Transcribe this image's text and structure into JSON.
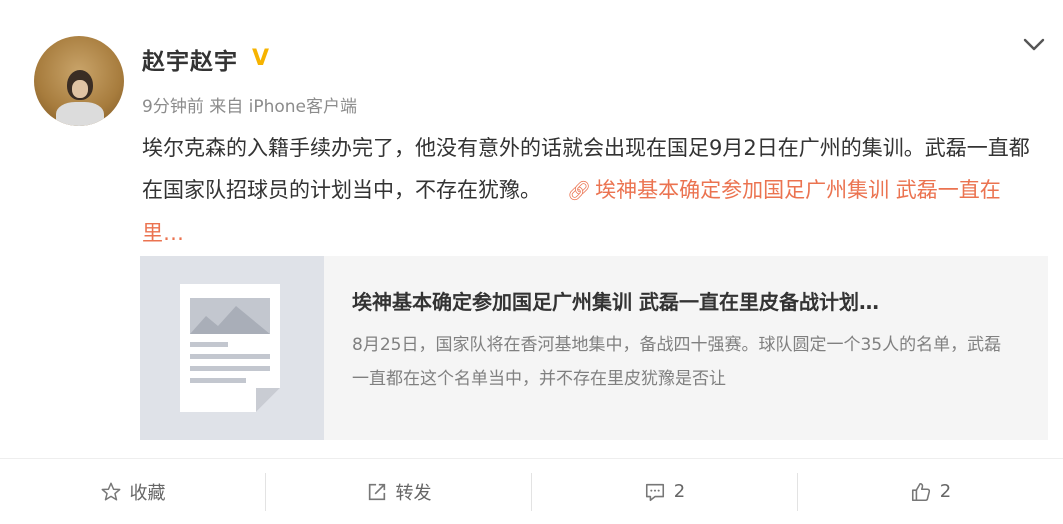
{
  "user": {
    "name": "赵宇赵宇",
    "verified_badge": "V",
    "meta": "9分钟前 来自 iPhone客户端"
  },
  "post": {
    "text": "埃尔克森的入籍手续办完了，他没有意外的话就会出现在国足9月2日在广州的集训。武磊一直都在国家队招球员的计划当中，不存在犹豫。",
    "link_text": "埃神基本确定参加国足广州集训 武磊一直在里…"
  },
  "card": {
    "title": "埃神基本确定参加国足广州集训 武磊一直在里皮备战计划…",
    "description": "8月25日，国家队将在香河基地集中，备战四十强赛。球队圆定一个35人的名单，武磊一直都在这个名单当中，并不存在里皮犹豫是否让"
  },
  "actions": {
    "favorite": "收藏",
    "repost": "转发",
    "comment_count": "2",
    "like_count": "2"
  },
  "colors": {
    "link": "#eb7350",
    "verified": "#f6b300"
  }
}
